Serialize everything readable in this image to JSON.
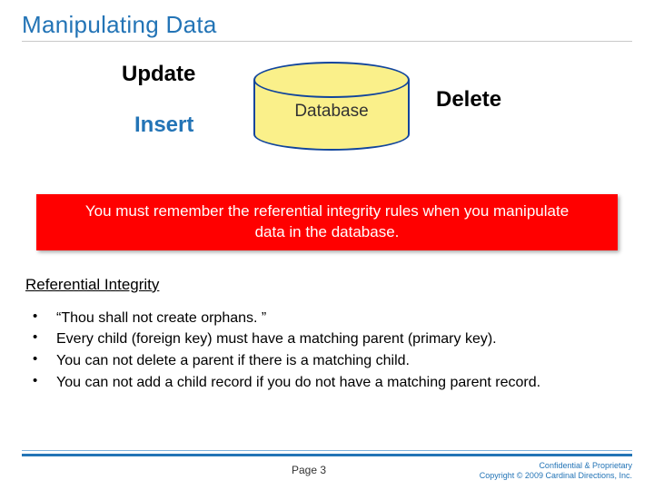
{
  "title": "Manipulating Data",
  "keywords": {
    "update": "Update",
    "insert": "Insert",
    "delete": "Delete"
  },
  "db_label": "Database",
  "callout_line1": "You must remember the referential integrity rules when you manipulate",
  "callout_line2": "data in the database.",
  "section_head": "Referential Integrity",
  "bullets": [
    "“Thou shall not create orphans. ”",
    "Every child (foreign key) must have a matching parent (primary key).",
    "You can not delete a parent if there is a matching child.",
    "You can not add a child record if you do not have a matching parent record."
  ],
  "footer": {
    "page_label": "Page 3",
    "conf1": "Confidential & Proprietary",
    "conf2": "Copyright © 2009 Cardinal Directions, Inc."
  }
}
